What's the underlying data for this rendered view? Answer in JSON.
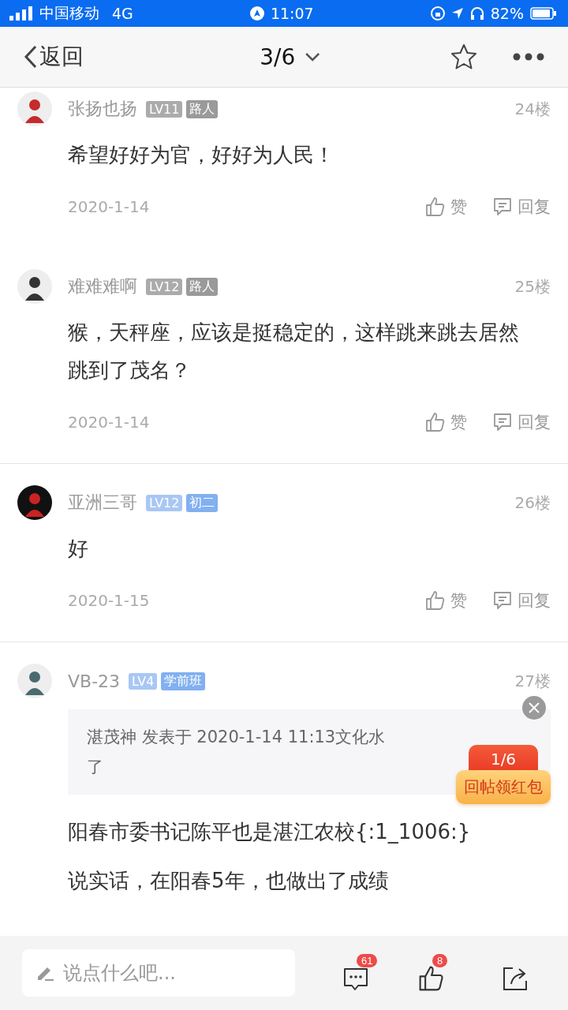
{
  "status_bar": {
    "carrier": "中国移动",
    "network": "4G",
    "time": "11:07",
    "battery": "82%"
  },
  "nav": {
    "back": "返回",
    "page": "3/6"
  },
  "comments": [
    {
      "name": "张扬也扬",
      "badges": [
        {
          "text": "LV11",
          "color": "#ababab"
        },
        {
          "text": "路人",
          "color": "#9a9a9a"
        }
      ],
      "floor": "24楼",
      "lines": [
        "希望好好为官，好好为人民！"
      ],
      "date": "2020-1-14",
      "like": "赞",
      "reply": "回复"
    },
    {
      "name": "难难难啊",
      "badges": [
        {
          "text": "LV12",
          "color": "#ababab"
        },
        {
          "text": "路人",
          "color": "#9a9a9a"
        }
      ],
      "floor": "25楼",
      "lines": [
        "猴，天秤座，应该是挺稳定的，这样跳来跳去居然跳到了茂名？"
      ],
      "date": "2020-1-14",
      "like": "赞",
      "reply": "回复"
    },
    {
      "name": "亚洲三哥",
      "badges": [
        {
          "text": "LV12",
          "color": "#a9c7f4"
        },
        {
          "text": "初二",
          "color": "#82b0f0"
        }
      ],
      "floor": "26楼",
      "lines": [
        "好"
      ],
      "date": "2020-1-15",
      "like": "赞",
      "reply": "回复"
    },
    {
      "name": "VB-23",
      "badges": [
        {
          "text": "LV4",
          "color": "#a9c7f4"
        },
        {
          "text": "学前班",
          "color": "#82b0f0"
        }
      ],
      "floor": "27楼",
      "quote": [
        "湛茂神 发表于 2020-1-14 11:13文化水",
        "了"
      ],
      "lines": [
        "阳春市委书记陈平也是湛江农校{:1_1006:}",
        "说实话，在阳春5年，也做出了成绩"
      ]
    }
  ],
  "red_packet": {
    "count": "1/6",
    "label": "回帖领红包"
  },
  "bottom_bar": {
    "placeholder": "说点什么吧...",
    "comment_count": "61",
    "like_count": "8"
  }
}
